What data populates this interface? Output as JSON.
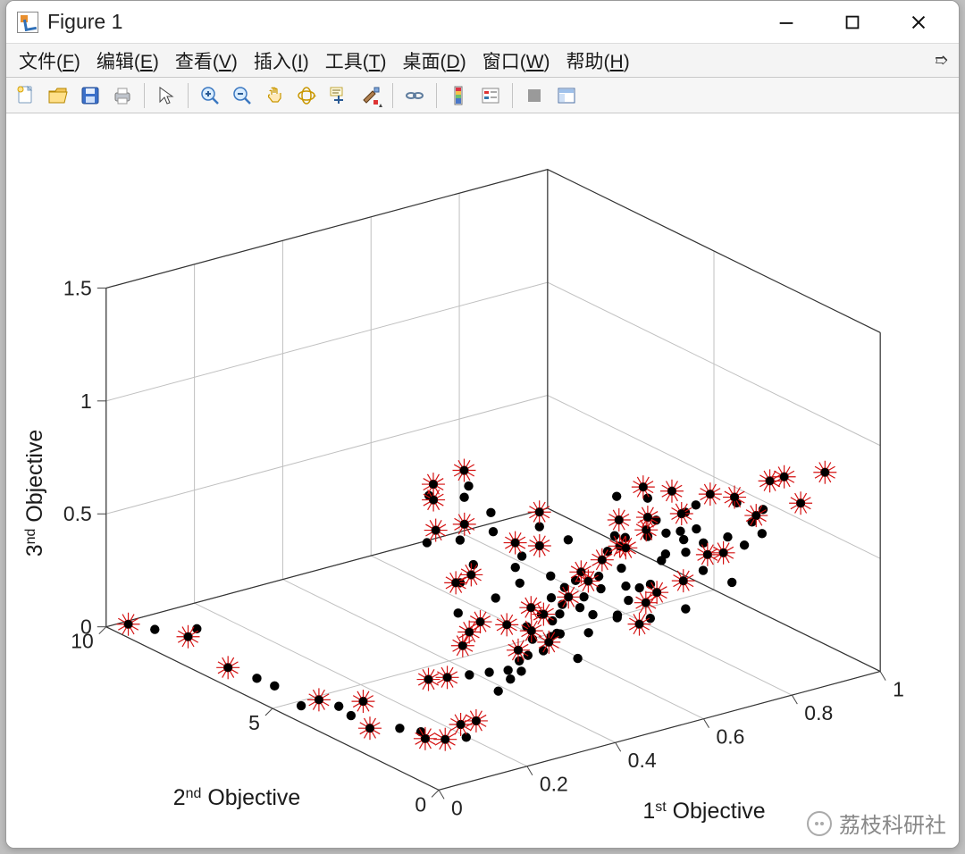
{
  "window": {
    "title": "Figure 1"
  },
  "menu": {
    "file": "文件(F)",
    "edit": "编辑(E)",
    "view": "查看(V)",
    "insert": "插入(I)",
    "tools": "工具(T)",
    "desktop": "桌面(D)",
    "window": "窗口(W)",
    "help": "帮助(H)"
  },
  "toolbar": {
    "new": "new-figure-icon",
    "open": "open-icon",
    "save": "save-icon",
    "print": "print-icon",
    "pointer": "pointer-icon",
    "zoomin": "zoom-in-icon",
    "zoomout": "zoom-out-icon",
    "pan": "pan-icon",
    "rotate": "rotate-3d-icon",
    "datatip": "data-cursor-icon",
    "brush": "brush-icon",
    "link": "link-icon",
    "colorbar": "colorbar-icon",
    "legend": "legend-icon",
    "stop": "stop-icon",
    "layout": "layout-icon"
  },
  "watermark": "荔枝科研社",
  "chart_data": {
    "type": "scatter",
    "title": "",
    "xlabel_html": "1<sup>st</sup> Objective",
    "ylabel_html": "2<sup>nd</sup> Objective",
    "zlabel_html": "3<sup>nd</sup> Objective",
    "xlabel": "1st Objective",
    "ylabel": "2nd Objective",
    "zlabel": "3nd Objective",
    "x_range": [
      0,
      1
    ],
    "y_range": [
      0,
      10
    ],
    "z_range": [
      0,
      1.5
    ],
    "x_ticks": [
      0,
      0.2,
      0.4,
      0.6,
      0.8,
      1
    ],
    "y_ticks": [
      0,
      5,
      10
    ],
    "z_ticks": [
      0,
      0.5,
      1,
      1.5
    ],
    "series": [
      {
        "name": "points",
        "marker": "dot",
        "color": "#000000",
        "points": [
          [
            0.02,
            9.6,
            0.03
          ],
          [
            0.05,
            9.2,
            0.02
          ],
          [
            0.05,
            8.2,
            0.06
          ],
          [
            0.05,
            7.0,
            0.01
          ],
          [
            0.04,
            6.0,
            0.04
          ],
          [
            0.05,
            5.6,
            0.03
          ],
          [
            0.05,
            4.8,
            0.0
          ],
          [
            0.06,
            4.4,
            0.05
          ],
          [
            0.09,
            4.2,
            0.02
          ],
          [
            0.08,
            3.7,
            0.02
          ],
          [
            0.1,
            3.6,
            0.08
          ],
          [
            0.07,
            3.0,
            0.02
          ],
          [
            0.1,
            2.5,
            0.04
          ],
          [
            0.12,
            2.0,
            0.02
          ],
          [
            0.08,
            1.6,
            0.1
          ],
          [
            0.12,
            1.4,
            0.06
          ],
          [
            0.14,
            1.2,
            0.13
          ],
          [
            0.13,
            0.9,
            0.1
          ],
          [
            0.16,
            1.0,
            0.15
          ],
          [
            0.18,
            0.6,
            0.3
          ],
          [
            0.2,
            0.5,
            0.35
          ],
          [
            0.22,
            0.5,
            0.42
          ],
          [
            0.21,
            0.4,
            0.48
          ],
          [
            0.25,
            0.5,
            0.5
          ],
          [
            0.24,
            0.4,
            0.55
          ],
          [
            0.27,
            0.5,
            0.6
          ],
          [
            0.26,
            0.3,
            0.62
          ],
          [
            0.3,
            0.6,
            0.65
          ],
          [
            0.28,
            0.3,
            0.58
          ],
          [
            0.33,
            0.6,
            0.68
          ],
          [
            0.31,
            0.4,
            0.63
          ],
          [
            0.36,
            0.5,
            0.74
          ],
          [
            0.34,
            0.4,
            0.72
          ],
          [
            0.29,
            0.3,
            0.52
          ],
          [
            0.32,
            0.6,
            0.48
          ],
          [
            0.36,
            0.6,
            0.35
          ],
          [
            0.38,
            0.8,
            0.55
          ],
          [
            0.4,
            0.5,
            0.7
          ],
          [
            0.42,
            0.7,
            0.62
          ],
          [
            0.4,
            0.4,
            0.78
          ],
          [
            0.42,
            0.5,
            0.8
          ],
          [
            0.44,
            0.4,
            0.82
          ],
          [
            0.46,
            0.5,
            0.84
          ],
          [
            0.5,
            0.4,
            0.86
          ],
          [
            0.53,
            0.5,
            0.88
          ],
          [
            0.58,
            0.4,
            0.89
          ],
          [
            0.62,
            0.5,
            0.9
          ],
          [
            0.56,
            0.6,
            0.8
          ],
          [
            0.6,
            0.6,
            0.75
          ],
          [
            0.66,
            0.6,
            0.92
          ],
          [
            0.7,
            0.4,
            0.9
          ],
          [
            0.72,
            0.6,
            0.85
          ],
          [
            0.78,
            0.4,
            0.93
          ],
          [
            0.6,
            0.7,
            0.78
          ],
          [
            0.72,
            1.0,
            0.6
          ],
          [
            0.76,
            0.9,
            0.62
          ],
          [
            0.8,
            0.9,
            0.65
          ],
          [
            0.88,
            0.8,
            0.75
          ],
          [
            0.92,
            0.6,
            0.88
          ],
          [
            0.82,
            0.5,
            0.92
          ],
          [
            0.18,
            2.7,
            0.2
          ],
          [
            0.2,
            2.4,
            0.22
          ],
          [
            0.22,
            2.0,
            0.25
          ],
          [
            0.25,
            1.8,
            0.26
          ],
          [
            0.27,
            1.5,
            0.28
          ],
          [
            0.3,
            1.5,
            0.26
          ],
          [
            0.33,
            1.7,
            0.3
          ],
          [
            0.38,
            1.9,
            0.28
          ],
          [
            0.4,
            2.0,
            0.3
          ],
          [
            0.25,
            2.6,
            0.32
          ],
          [
            0.28,
            2.8,
            0.35
          ],
          [
            0.32,
            3.0,
            0.36
          ],
          [
            0.35,
            2.6,
            0.36
          ],
          [
            0.38,
            2.4,
            0.35
          ],
          [
            0.42,
            2.2,
            0.3
          ],
          [
            0.3,
            3.4,
            0.38
          ],
          [
            0.34,
            4.0,
            0.45
          ],
          [
            0.38,
            4.4,
            0.4
          ],
          [
            0.42,
            4.6,
            0.4
          ],
          [
            0.44,
            4.8,
            0.42
          ],
          [
            0.35,
            5.0,
            0.55
          ],
          [
            0.4,
            5.4,
            0.55
          ],
          [
            0.44,
            5.2,
            0.5
          ],
          [
            0.48,
            5.6,
            0.52
          ],
          [
            0.52,
            4.6,
            0.38
          ],
          [
            0.5,
            4.2,
            0.35
          ],
          [
            0.55,
            4.8,
            0.4
          ],
          [
            0.58,
            5.4,
            0.4
          ],
          [
            0.62,
            5.2,
            0.38
          ],
          [
            0.6,
            4.6,
            0.3
          ],
          [
            0.65,
            5.6,
            0.42
          ],
          [
            0.68,
            6.0,
            0.44
          ],
          [
            0.7,
            5.4,
            0.35
          ],
          [
            0.6,
            3.6,
            0.28
          ],
          [
            0.64,
            4.0,
            0.3
          ],
          [
            0.68,
            3.4,
            0.3
          ],
          [
            0.7,
            3.8,
            0.34
          ],
          [
            0.74,
            4.2,
            0.38
          ],
          [
            0.76,
            4.8,
            0.38
          ],
          [
            0.8,
            5.2,
            0.4
          ],
          [
            0.82,
            4.6,
            0.36
          ],
          [
            0.85,
            5.0,
            0.4
          ],
          [
            0.84,
            5.8,
            0.44
          ],
          [
            0.88,
            5.4,
            0.44
          ],
          [
            0.9,
            5.8,
            0.45
          ],
          [
            0.92,
            4.8,
            0.4
          ],
          [
            0.95,
            5.6,
            0.42
          ],
          [
            0.46,
            6.4,
            0.6
          ],
          [
            0.5,
            6.8,
            0.6
          ],
          [
            0.54,
            6.4,
            0.55
          ],
          [
            0.58,
            6.8,
            0.55
          ],
          [
            0.6,
            7.2,
            0.58
          ],
          [
            0.44,
            6.0,
            0.62
          ],
          [
            0.5,
            5.0,
            0.52
          ],
          [
            0.54,
            5.6,
            0.54
          ],
          [
            0.4,
            3.6,
            0.38
          ],
          [
            0.45,
            3.2,
            0.34
          ],
          [
            0.5,
            3.0,
            0.3
          ],
          [
            0.55,
            3.4,
            0.32
          ],
          [
            0.52,
            2.4,
            0.25
          ],
          [
            0.56,
            2.8,
            0.28
          ],
          [
            0.6,
            2.6,
            0.26
          ],
          [
            0.62,
            2.2,
            0.25
          ],
          [
            0.66,
            2.4,
            0.24
          ],
          [
            0.68,
            2.8,
            0.27
          ],
          [
            0.72,
            3.0,
            0.28
          ],
          [
            0.74,
            2.4,
            0.24
          ],
          [
            0.78,
            3.0,
            0.3
          ],
          [
            0.8,
            3.8,
            0.35
          ],
          [
            0.84,
            3.2,
            0.3
          ],
          [
            0.86,
            2.6,
            0.28
          ],
          [
            0.88,
            3.6,
            0.32
          ],
          [
            0.9,
            4.2,
            0.38
          ],
          [
            0.64,
            1.8,
            0.55
          ],
          [
            0.68,
            1.6,
            0.58
          ],
          [
            0.72,
            1.6,
            0.6
          ],
          [
            0.76,
            1.4,
            0.62
          ],
          [
            0.8,
            1.2,
            0.68
          ],
          [
            0.84,
            1.4,
            0.7
          ],
          [
            0.56,
            1.4,
            0.5
          ],
          [
            0.6,
            1.6,
            0.48
          ],
          [
            0.48,
            1.0,
            0.45
          ],
          [
            0.52,
            1.2,
            0.48
          ],
          [
            0.96,
            3.2,
            0.48
          ],
          [
            0.1,
            8.6,
            0.04
          ]
        ]
      },
      {
        "name": "highlighted",
        "marker": "star",
        "color": "#d41111",
        "points": [
          [
            0.02,
            9.6,
            0.03
          ],
          [
            0.05,
            8.2,
            0.06
          ],
          [
            0.05,
            7.0,
            0.01
          ],
          [
            0.06,
            4.4,
            0.05
          ],
          [
            0.1,
            3.6,
            0.08
          ],
          [
            0.07,
            3.0,
            0.02
          ],
          [
            0.12,
            2.0,
            0.02
          ],
          [
            0.12,
            1.4,
            0.06
          ],
          [
            0.14,
            1.2,
            0.13
          ],
          [
            0.16,
            1.0,
            0.15
          ],
          [
            0.21,
            0.4,
            0.48
          ],
          [
            0.24,
            0.4,
            0.55
          ],
          [
            0.26,
            0.3,
            0.62
          ],
          [
            0.36,
            0.5,
            0.74
          ],
          [
            0.4,
            0.4,
            0.78
          ],
          [
            0.44,
            0.4,
            0.82
          ],
          [
            0.5,
            0.4,
            0.86
          ],
          [
            0.58,
            0.4,
            0.89
          ],
          [
            0.66,
            0.6,
            0.92
          ],
          [
            0.7,
            0.4,
            0.9
          ],
          [
            0.78,
            0.4,
            0.93
          ],
          [
            0.92,
            0.6,
            0.88
          ],
          [
            0.82,
            0.5,
            0.92
          ],
          [
            0.2,
            2.4,
            0.22
          ],
          [
            0.25,
            2.6,
            0.32
          ],
          [
            0.28,
            2.8,
            0.35
          ],
          [
            0.34,
            4.0,
            0.45
          ],
          [
            0.42,
            4.6,
            0.4
          ],
          [
            0.4,
            5.4,
            0.55
          ],
          [
            0.48,
            5.6,
            0.52
          ],
          [
            0.58,
            5.4,
            0.4
          ],
          [
            0.62,
            5.2,
            0.38
          ],
          [
            0.68,
            6.0,
            0.44
          ],
          [
            0.74,
            4.2,
            0.38
          ],
          [
            0.8,
            5.2,
            0.4
          ],
          [
            0.85,
            5.0,
            0.4
          ],
          [
            0.9,
            5.8,
            0.45
          ],
          [
            0.95,
            5.6,
            0.42
          ],
          [
            0.5,
            6.8,
            0.6
          ],
          [
            0.6,
            7.2,
            0.58
          ],
          [
            0.44,
            6.0,
            0.62
          ],
          [
            0.45,
            3.2,
            0.34
          ],
          [
            0.55,
            3.4,
            0.32
          ],
          [
            0.62,
            2.2,
            0.25
          ],
          [
            0.68,
            2.8,
            0.27
          ],
          [
            0.78,
            3.0,
            0.3
          ],
          [
            0.88,
            3.6,
            0.32
          ],
          [
            0.96,
            3.2,
            0.48
          ],
          [
            0.4,
            2.0,
            0.3
          ],
          [
            0.72,
            1.0,
            0.6
          ],
          [
            0.88,
            0.8,
            0.75
          ],
          [
            0.32,
            3.0,
            0.36
          ],
          [
            0.64,
            4.0,
            0.3
          ],
          [
            0.35,
            2.6,
            0.36
          ],
          [
            0.18,
            2.7,
            0.2
          ],
          [
            0.72,
            3.0,
            0.28
          ]
        ]
      }
    ]
  }
}
